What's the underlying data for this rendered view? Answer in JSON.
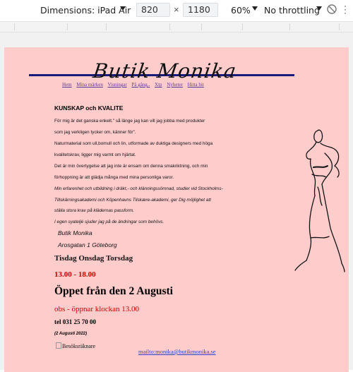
{
  "devtools": {
    "dimensions_label": "Dimensions: iPad Air",
    "width_value": "820",
    "times": "×",
    "height_value": "1180",
    "zoom": "60%",
    "throttling": "No throttling"
  },
  "site": {
    "logo_text": "Butik Monika",
    "nav": [
      "Hem",
      "Mina märken",
      "Visningar",
      "På gång..",
      "Xtp",
      "Nyheter",
      "Hitta hit"
    ],
    "heading": "KUNSKAP och KVALITE",
    "paragraphs": [
      "För mig är det ganska enkelt.\" så länge jag kan vill jag jobba med produkter",
      "som jag verkligen tycker om, känner för\".",
      "Naturmaterial som ull,bomull och lin, utformade av duktiga designers med höga",
      "kvalitetskrav, ligger mig varmt om hjärtat.",
      "Det är min övertygelse att jag inte är ensam om denna smakriktning, och min",
      "förhoppning är att glädja många med mina personliga varor."
    ],
    "italic_paragraphs": [
      "Min erfarenhet och utbildning i dräkt,- och klänningssömnad, studier vid Stockholms-",
      "Tillskärningsakademi och Köpenhavns Tilskære-akademi, ger Dig möjlighet att",
      "ställa stora krav på klädernas passform.",
      "I egen syateljé sjuder jag på de ändringar som behövs."
    ],
    "address_name": "Butik Monika",
    "address_street": "Arosgatan 1  Göteborg",
    "days": "Tisdag  Onsdag  Torsdag",
    "hours": "13.00 - 18.00",
    "open_notice": "Öppet från den 2 Augusti",
    "obs": "obs - öppnar klockan  13.00",
    "tel": "tel  031 25 70 00",
    "date_note": "(2 Augusti 2022)",
    "counter_alt": "Besöksräknare",
    "email_link": "mailto:monika@butikmonika.se"
  },
  "colors": {
    "page_bg": "#ffcccc",
    "accent_bar": "#1a1a7a",
    "red_text": "#cc0000",
    "nav_link": "#5a3a99"
  }
}
